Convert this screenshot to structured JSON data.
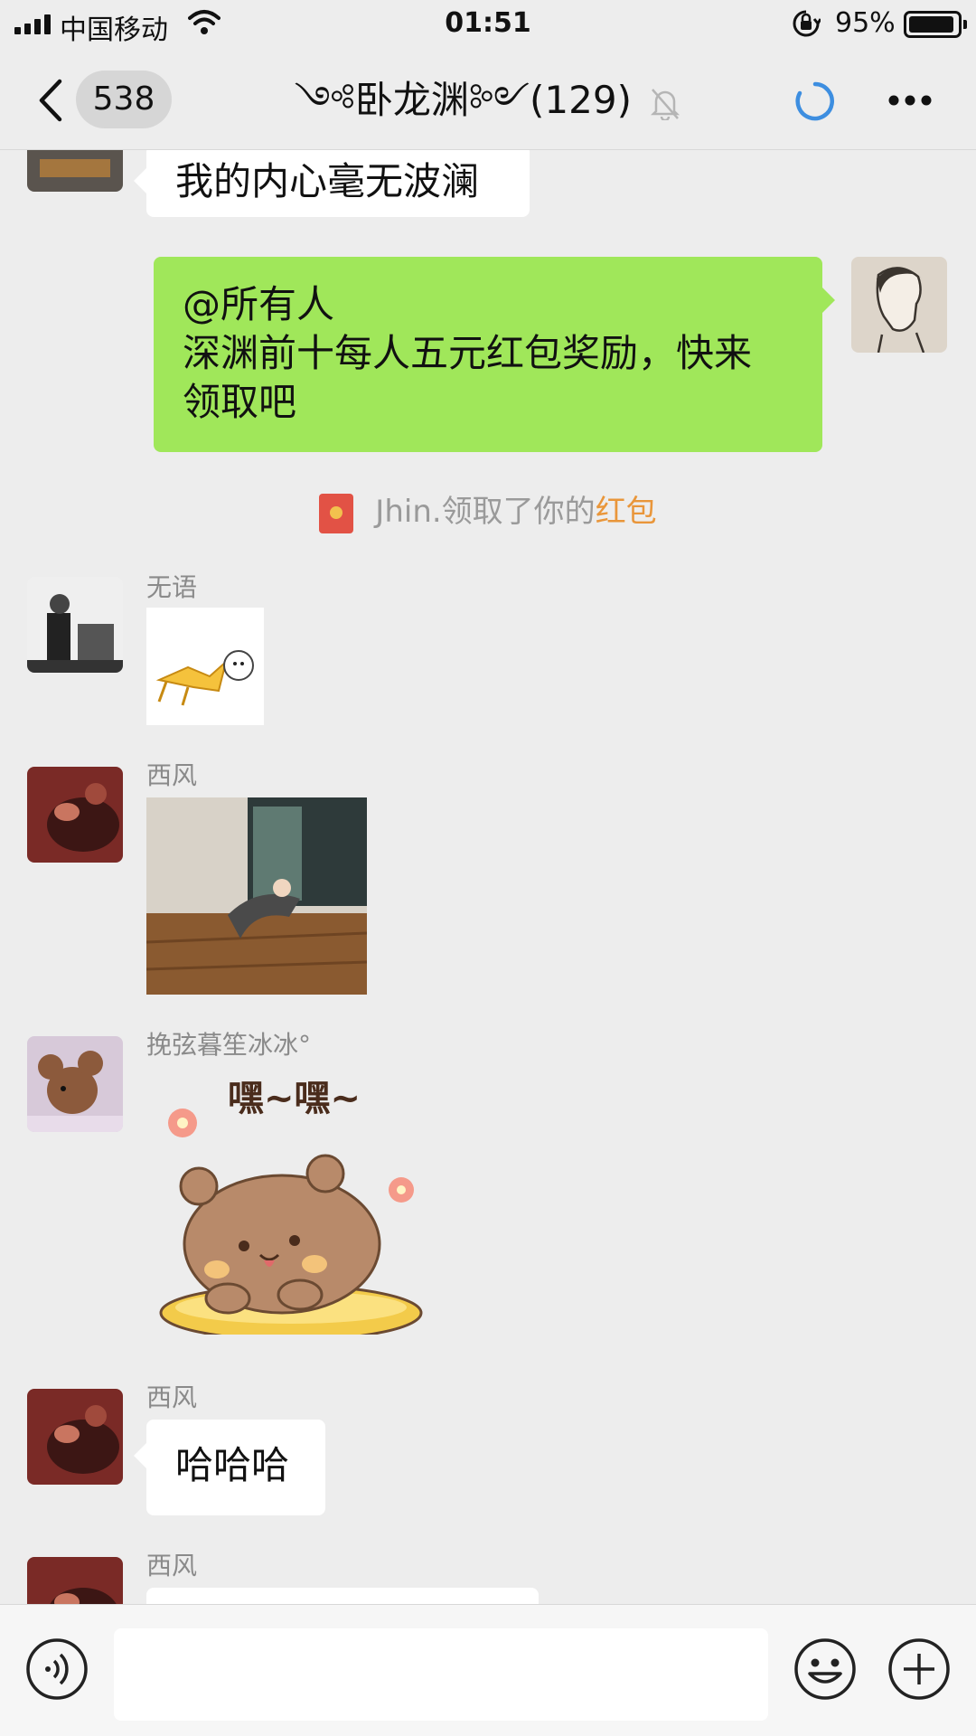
{
  "status_bar": {
    "carrier": "中国移动",
    "time": "01:51",
    "battery_percent": "95%",
    "icons": [
      "signal-icon",
      "wifi-icon",
      "orientation-lock-icon",
      "battery-icon"
    ]
  },
  "nav": {
    "unread_count": "538",
    "title": "༺卧龙渊༻(129)",
    "icons": [
      "back-icon",
      "muted-bell-icon",
      "sync-icon",
      "more-icon"
    ]
  },
  "messages": [
    {
      "type": "text",
      "side": "left",
      "text": "我的内心毫无波澜"
    },
    {
      "type": "text",
      "side": "right",
      "line1": "@所有人",
      "line2": "深渊前十每人五元红包奖励，快来",
      "line3": "领取吧"
    },
    {
      "type": "system",
      "prefix": "Jhin.领取了你的",
      "link": "红包",
      "link_color": "#e9963a"
    },
    {
      "type": "sticker",
      "side": "left",
      "sender": "无语"
    },
    {
      "type": "sticker",
      "side": "left",
      "sender": "西风"
    },
    {
      "type": "sticker",
      "side": "left",
      "sender": "挽弦暮笙冰冰°",
      "sticker_text": "嘿~嘿~"
    },
    {
      "type": "text",
      "side": "left",
      "sender": "西风",
      "text": "哈哈哈"
    },
    {
      "type": "text",
      "side": "left",
      "sender": "西风",
      "text": ""
    }
  ],
  "input_bar": {
    "value": "",
    "icons": [
      "voice-icon",
      "emoji-icon",
      "plus-icon"
    ]
  },
  "colors": {
    "background": "#ededed",
    "bubble_self": "#a0e75a",
    "bubble_other": "#ffffff",
    "accent": "#e9963a"
  }
}
